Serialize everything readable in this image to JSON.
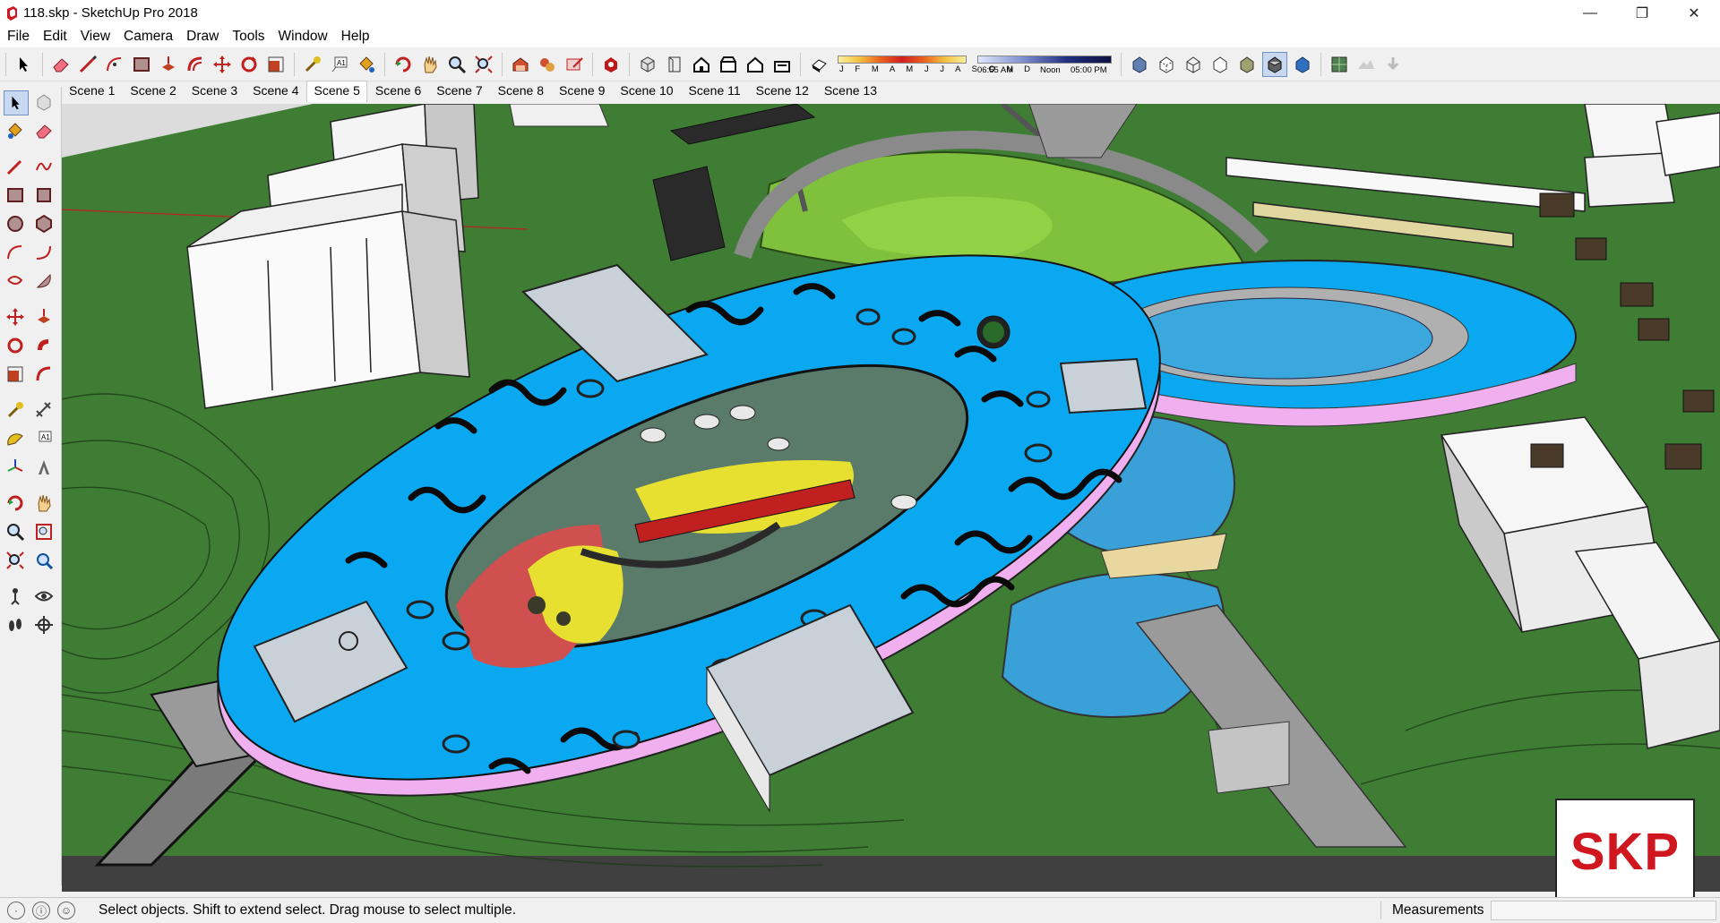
{
  "window": {
    "title": "118.skp - SketchUp Pro 2018",
    "controls": [
      "—",
      "❐",
      "✕"
    ]
  },
  "menu": [
    "File",
    "Edit",
    "View",
    "Camera",
    "Draw",
    "Tools",
    "Window",
    "Help"
  ],
  "shadows": {
    "months": "J F M A M J J A S O N D",
    "time_start": "06:55 AM",
    "time_noon": "Noon",
    "time_end": "05:00 PM"
  },
  "scenes": [
    "Scene 1",
    "Scene 2",
    "Scene 3",
    "Scene 4",
    "Scene 5",
    "Scene 6",
    "Scene 7",
    "Scene 8",
    "Scene 9",
    "Scene 10",
    "Scene 11",
    "Scene 12",
    "Scene 13"
  ],
  "active_scene": "Scene 5",
  "status": {
    "message": "Select objects. Shift to extend select. Drag mouse to select multiple.",
    "measurements_label": "Measurements",
    "measurements_value": ""
  },
  "watermark": "SKP",
  "colors": {
    "roof_blue": "#0aa8f0",
    "grass": "#3c7a32",
    "water": "#3aa0d8",
    "glass_pink": "#f0b0f0",
    "skp_red": "#d0171f"
  }
}
